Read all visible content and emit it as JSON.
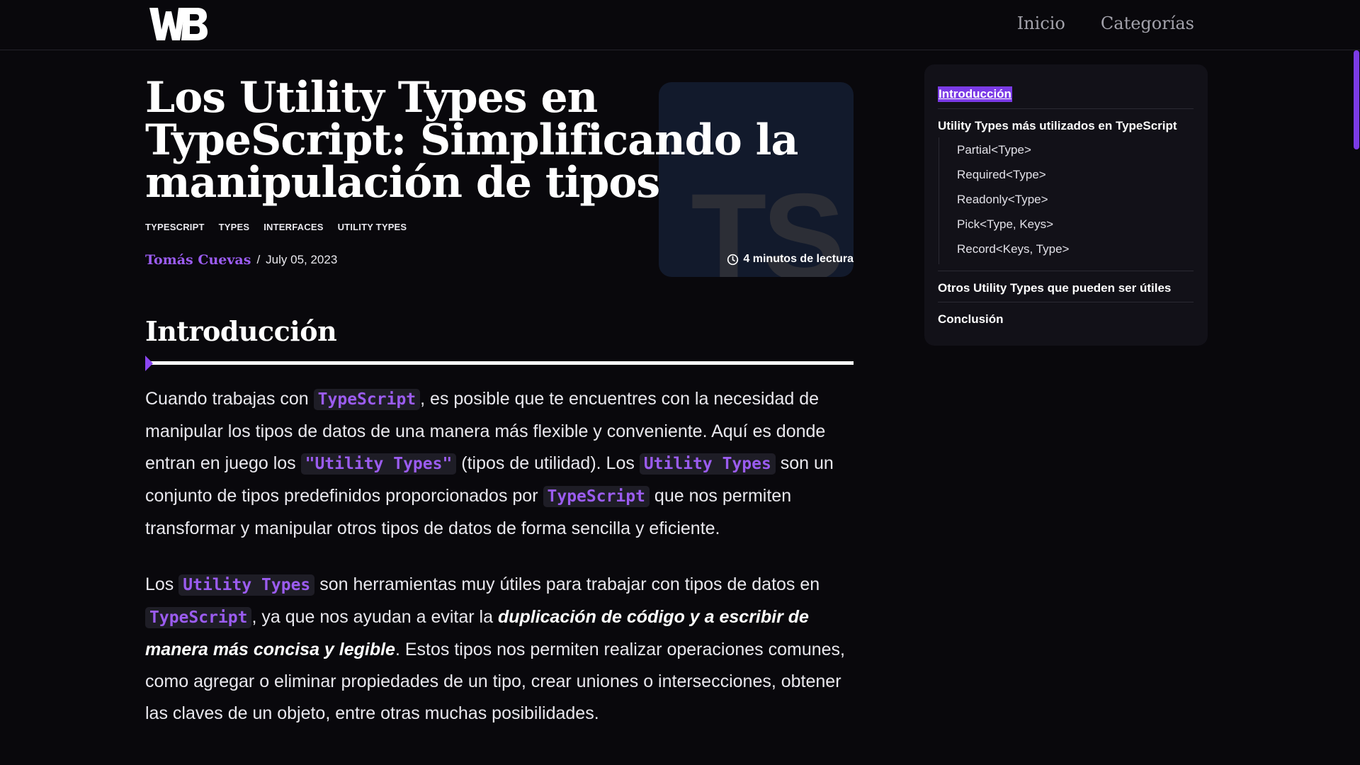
{
  "header": {
    "logo_alt": "WB",
    "nav": [
      {
        "label": "Inicio"
      },
      {
        "label": "Categorías"
      }
    ]
  },
  "article": {
    "hero_image": {
      "letters": "TS"
    },
    "title": "Los Utility Types en TypeScript: Simplificando la manipulación de tipos",
    "tags": [
      "TYPESCRIPT",
      "TYPES",
      "INTERFACES",
      "UTILITY TYPES"
    ],
    "author": "Tomás Cuevas",
    "separator": "/",
    "date": "July 05, 2023",
    "read_time": "4 minutos de lectura",
    "section_heading": "Introducción",
    "p1": {
      "t1": "Cuando trabajas con ",
      "c1": "TypeScript",
      "t2": ", es posible que te encuentres con la necesidad de manipular los tipos de datos de una manera más flexible y conveniente. Aquí es donde entran en juego los ",
      "c2": "\"Utility Types\"",
      "t3": " (tipos de utilidad). Los ",
      "c3": "Utility Types",
      "t4": " son un conjunto de tipos predefinidos proporcionados por ",
      "c4": "TypeScript",
      "t5": " que nos permiten transformar y manipular otros tipos de datos de forma sencilla y eficiente."
    },
    "p2": {
      "t1": "Los ",
      "c1": "Utility Types",
      "t2": " son herramientas muy útiles para trabajar con tipos de datos en ",
      "c2": "TypeScript",
      "t3": ", ya que nos ayudan a evitar la ",
      "e1": "duplicación de código y a escribir de manera más concisa y legible",
      "t4": ". Estos tipos nos permiten realizar operaciones comunes, como agregar o eliminar propiedades de un tipo, crear uniones o intersecciones, obtener las claves de un objeto, entre otras muchas posibilidades."
    }
  },
  "toc": {
    "active": "Introducción",
    "section2": "Utility Types más utilizados en TypeScript",
    "sub": [
      "Partial<Type>",
      "Required<Type>",
      "Readonly<Type>",
      "Pick<Type, Keys>",
      "Record<Keys, Type>"
    ],
    "section3": "Otros Utility Types que pueden ser útiles",
    "section4": "Conclusión"
  },
  "colors": {
    "background": "#09080c",
    "accent": "#9b5cf0",
    "accent_strong": "#7b3be6",
    "text": "#e9e8ee"
  },
  "icons": {
    "logo": "wb-logo",
    "clock": "clock-icon",
    "section_marker": "triangle-marker-icon"
  }
}
